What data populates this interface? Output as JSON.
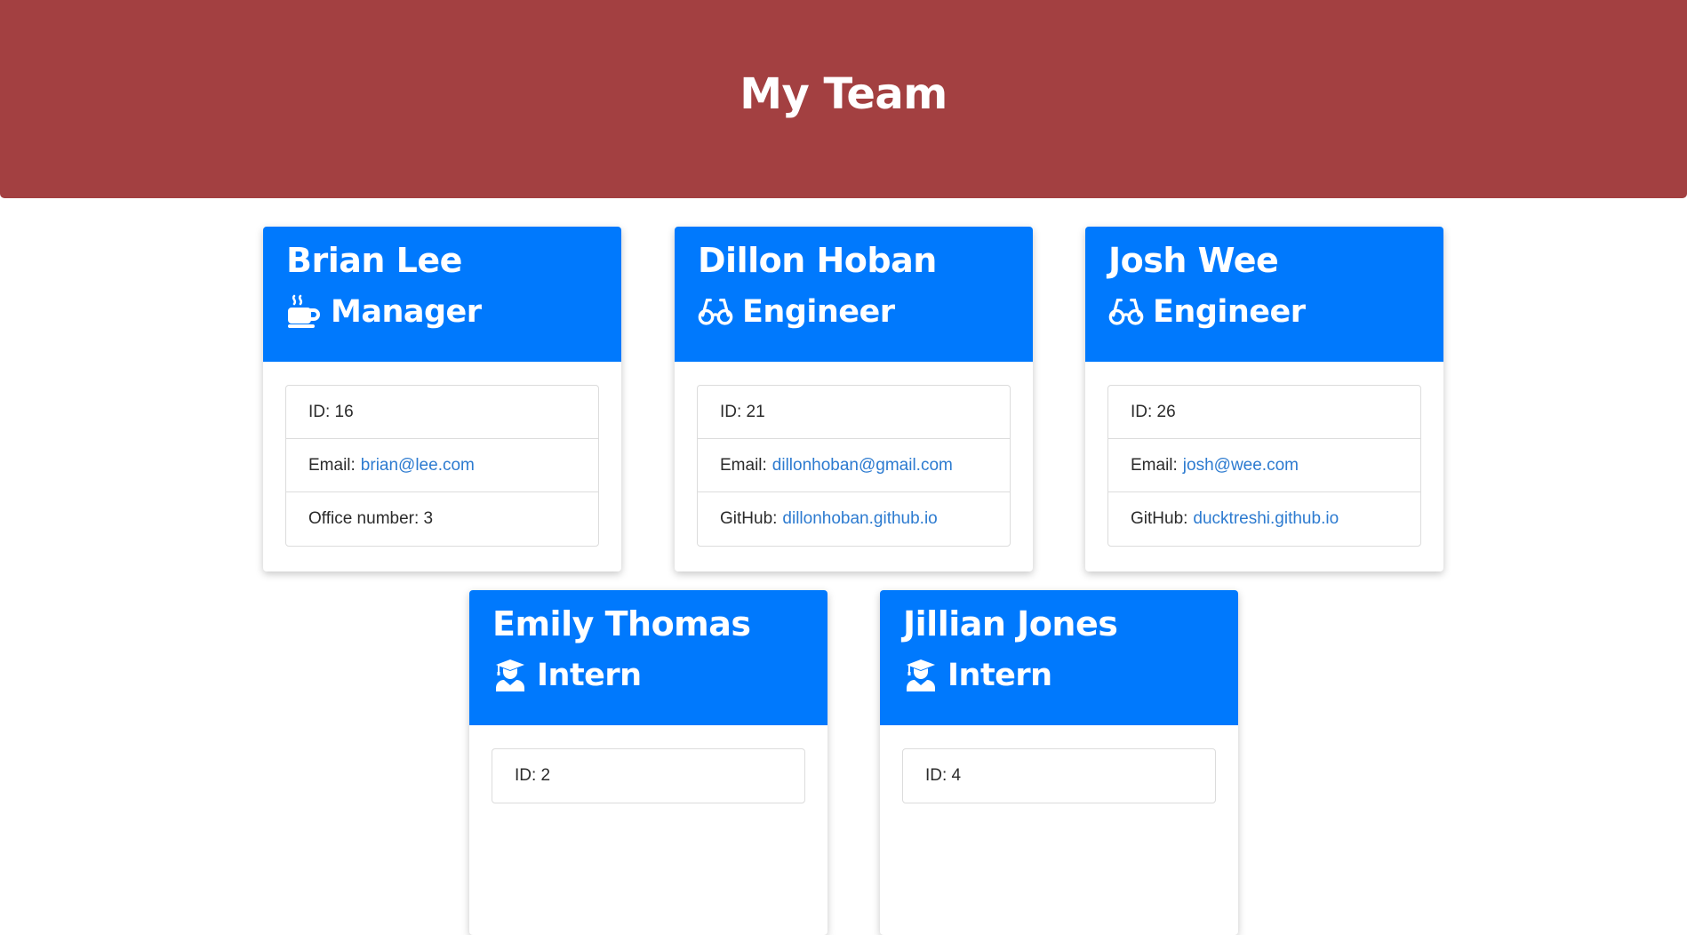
{
  "header": {
    "title": "My Team"
  },
  "cards": [
    {
      "name": "Brian Lee",
      "role": "Manager",
      "icon": "coffee-icon",
      "id_text": "ID: 16",
      "email_label": "Email:",
      "email": "brian@lee.com",
      "extra_label": "Office number: 3",
      "extra_link": ""
    },
    {
      "name": "Dillon Hoban",
      "role": "Engineer",
      "icon": "glasses-icon",
      "id_text": "ID: 21",
      "email_label": "Email:",
      "email": "dillonhoban@gmail.com",
      "extra_label": "GitHub:",
      "extra_link": "dillonhoban.github.io"
    },
    {
      "name": "Josh Wee",
      "role": "Engineer",
      "icon": "glasses-icon",
      "id_text": "ID: 26",
      "email_label": "Email:",
      "email": "josh@wee.com",
      "extra_label": "GitHub:",
      "extra_link": "ducktreshi.github.io"
    },
    {
      "name": "Emily Thomas",
      "role": "Intern",
      "icon": "graduate-icon",
      "id_text": "ID: 2"
    },
    {
      "name": "Jillian Jones",
      "role": "Intern",
      "icon": "graduate-icon",
      "id_text": "ID: 4"
    }
  ],
  "colors": {
    "header_bg": "#a34041",
    "card_header_bg": "#0079fd",
    "link": "#2d7bd0"
  }
}
